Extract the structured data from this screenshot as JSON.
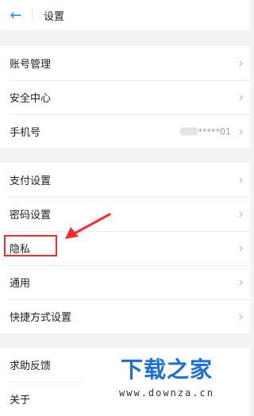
{
  "header": {
    "back_icon": "←",
    "title": "设置"
  },
  "chevron": "›",
  "group1": [
    {
      "label": "账号管理"
    },
    {
      "label": "安全中心"
    },
    {
      "label": "手机号",
      "value": "*****01"
    }
  ],
  "group2": [
    {
      "label": "支付设置"
    },
    {
      "label": "密码设置"
    },
    {
      "label": "隐私"
    },
    {
      "label": "通用"
    },
    {
      "label": "快捷方式设置"
    }
  ],
  "group3": [
    {
      "label": "求助反馈"
    },
    {
      "label": "关于"
    }
  ],
  "watermark": {
    "name": "下载之家",
    "url": "www.downza.cn"
  },
  "colors": {
    "accent": "#1a8cff",
    "annotation": "#ff2a2a",
    "watermark": "#1b6fd6"
  }
}
